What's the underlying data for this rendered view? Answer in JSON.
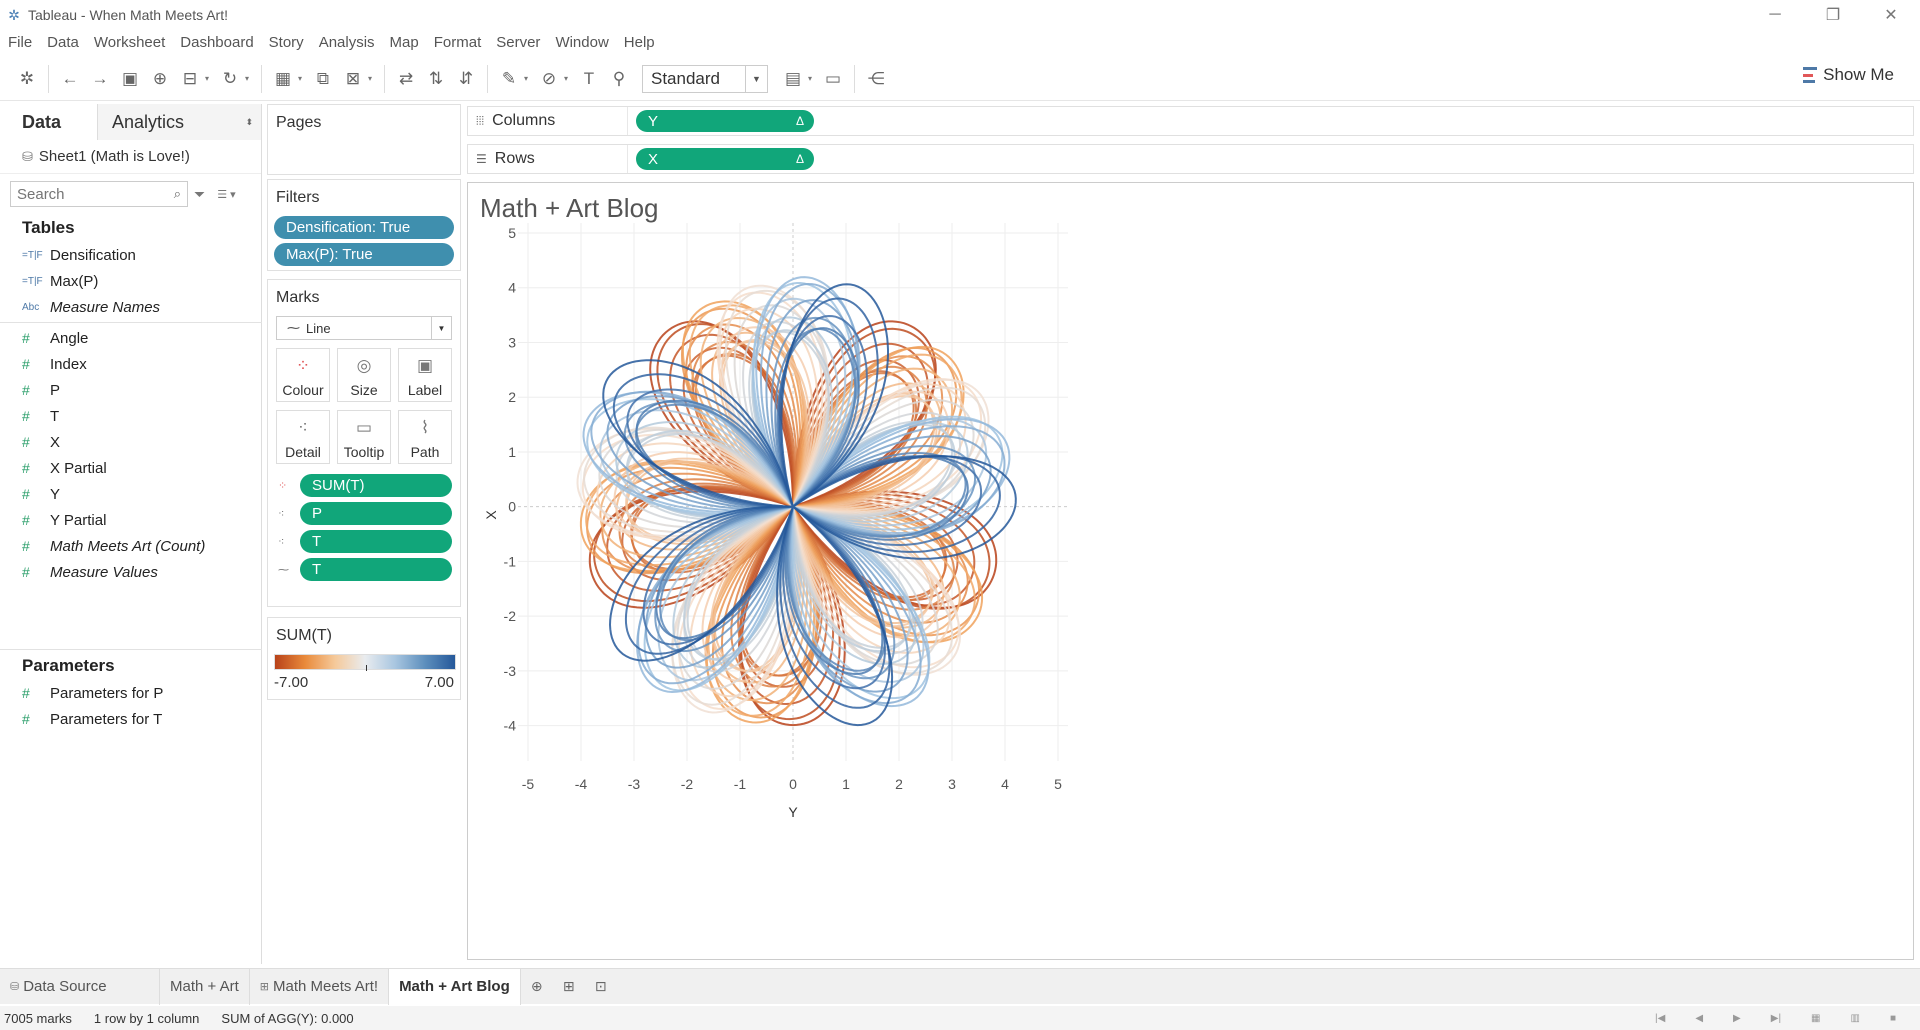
{
  "window": {
    "title": "Tableau - When Math Meets Art!"
  },
  "menu": [
    "File",
    "Data",
    "Worksheet",
    "Dashboard",
    "Story",
    "Analysis",
    "Map",
    "Format",
    "Server",
    "Window",
    "Help"
  ],
  "toolbar": {
    "fit": "Standard",
    "show_me": "Show Me"
  },
  "data_pane": {
    "tab_data": "Data",
    "tab_analytics": "Analytics",
    "datasource": "Sheet1 (Math is Love!)",
    "search_placeholder": "Search",
    "tables_heading": "Tables",
    "dimensions": [
      {
        "icon": "=T|F",
        "label": "Densification"
      },
      {
        "icon": "=T|F",
        "label": "Max(P)"
      },
      {
        "icon": "Abc",
        "label": "Measure Names"
      }
    ],
    "measures": [
      {
        "label": "Angle"
      },
      {
        "label": "Index"
      },
      {
        "label": "P"
      },
      {
        "label": "T"
      },
      {
        "label": "X"
      },
      {
        "label": "X Partial"
      },
      {
        "label": "Y"
      },
      {
        "label": "Y Partial"
      },
      {
        "label": "Math Meets Art (Count)"
      },
      {
        "label": "Measure Values"
      }
    ],
    "parameters_heading": "Parameters",
    "parameters": [
      {
        "label": "Parameters for P"
      },
      {
        "label": "Parameters for T"
      }
    ]
  },
  "pages": {
    "title": "Pages"
  },
  "filters": {
    "title": "Filters",
    "items": [
      "Densification: True",
      "Max(P): True"
    ]
  },
  "marks": {
    "title": "Marks",
    "type": "Line",
    "buttons": [
      "Colour",
      "Size",
      "Label",
      "Detail",
      "Tooltip",
      "Path"
    ],
    "pills": [
      "SUM(T)",
      "P",
      "T",
      "T"
    ]
  },
  "legend": {
    "title": "SUM(T)",
    "min": "-7.00",
    "max": "7.00"
  },
  "shelves": {
    "columns_label": "Columns",
    "columns_pill": "Y",
    "rows_label": "Rows",
    "rows_pill": "X",
    "delta": "Δ"
  },
  "view": {
    "title": "Math + Art Blog"
  },
  "chart_data": {
    "type": "line",
    "title": "Math + Art Blog",
    "xlabel": "Y",
    "ylabel": "X",
    "xlim": [
      -5,
      5
    ],
    "ylim": [
      -4.5,
      5
    ],
    "x_ticks": [
      "-5",
      "-4",
      "-3",
      "-2",
      "-1",
      "0",
      "1",
      "2",
      "3",
      "4",
      "5"
    ],
    "y_ticks": [
      "5",
      "4",
      "3",
      "2",
      "1",
      "0",
      "-1",
      "-2",
      "-3",
      "-4"
    ],
    "grid": true,
    "color_field": "SUM(T)",
    "color_range": [
      -7,
      7
    ],
    "colors": {
      "low": "#b8421a",
      "mid_low": "#f0a05a",
      "mid_high": "#9ec2e0",
      "high": "#25589a"
    },
    "description_free_shape": {
      "petals": 5,
      "max_radius": 4.8
    }
  },
  "sheet_tabs": {
    "data_source": "Data Source",
    "tabs": [
      "Math + Art",
      "Math Meets Art!",
      "Math + Art Blog"
    ]
  },
  "status": {
    "marks": "7005 marks",
    "dims": "1 row by 1 column",
    "sum": "SUM of AGG(Y): 0.000"
  }
}
